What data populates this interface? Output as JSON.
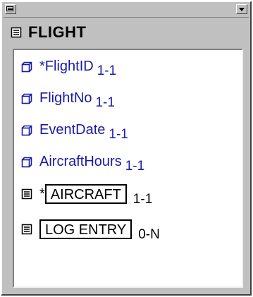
{
  "window": {
    "entity_icon": "entity-icon",
    "title": "FLIGHT"
  },
  "attributes": [
    {
      "prefix": "*",
      "name": "FlightID",
      "card": "1-1",
      "icon": "attribute-icon"
    },
    {
      "prefix": "",
      "name": "FlightNo",
      "card": "1-1",
      "icon": "attribute-icon"
    },
    {
      "prefix": "",
      "name": "EventDate",
      "card": "1-1",
      "icon": "attribute-icon"
    },
    {
      "prefix": "",
      "name": "AircraftHours",
      "card": "1-1",
      "icon": "attribute-icon"
    }
  ],
  "relationships": [
    {
      "prefix": "*",
      "name": "AIRCRAFT",
      "card": "1-1",
      "icon": "entity-ref-icon"
    },
    {
      "prefix": "",
      "name": "LOG ENTRY",
      "card": "0-N",
      "icon": "entity-ref-icon"
    }
  ],
  "colors": {
    "attribute_text": "#1a1aa6",
    "frame": "#c0c0c0",
    "panel": "#ffffff"
  }
}
